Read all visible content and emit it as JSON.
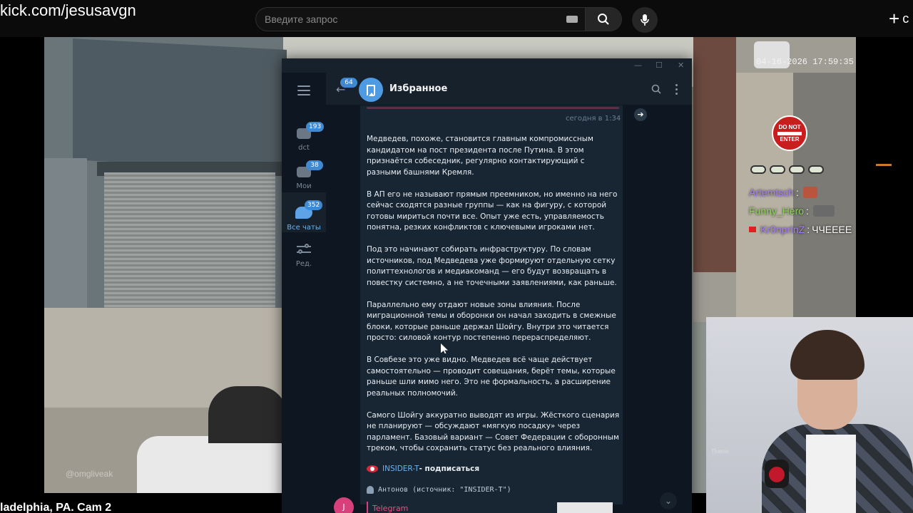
{
  "browser": {
    "url_text": "kick.com/jesusavgn",
    "search_placeholder": "Введите запрос",
    "icons": [
      "keyboard-icon",
      "search-icon",
      "mic-icon",
      "plus-icon"
    ],
    "create_label": "c"
  },
  "camera": {
    "timestamp": "04-16-2026 17:59:35",
    "caption": "ladelphia, PA. Cam 2",
    "watermark": "@omgliveak",
    "stop_sign": [
      "DO NOT",
      "ENTER"
    ]
  },
  "stream_chat": {
    "messages": [
      {
        "user": "Artemtsch",
        "color": "#a97bff",
        "text": ""
      },
      {
        "user": "Funny_Hero",
        "color": "#8bd35a",
        "text": ""
      },
      {
        "user": "Kr0nprInZ",
        "color": "#a97bff",
        "text": "ЧЧЕЕЕЕ"
      }
    ]
  },
  "webcam": {
    "label": "Пчела"
  },
  "telegram": {
    "window_controls": [
      "—",
      "☐",
      "✕"
    ],
    "folders": [
      {
        "label": "dct",
        "badge": "193",
        "icon": "chat-folder-icon"
      },
      {
        "label": "Мои друзья",
        "badge": "38",
        "icon": "chat-folder-icon"
      },
      {
        "label": "Все чаты",
        "badge": "352",
        "icon": "chats-icon",
        "active": true
      },
      {
        "label": "Ред.",
        "badge": "",
        "icon": "edit-folders-icon"
      }
    ],
    "back_badge": "64",
    "chat_title": "Избранное",
    "message": {
      "time": "сегодня в 1:34",
      "paragraphs": [
        "Медведев, похоже, становится главным компромиссным кандидатом на пост президента после Путина. В этом признаётся собеседник, регулярно контактирующий с разными башнями Кремля.",
        "В АП его не называют прямым преемником, но именно на него сейчас сходятся разные группы — как на фигуру, с которой готовы мириться почти все. Опыт уже есть, управляемость понятна, резких конфликтов с ключевыми игроками нет.",
        "Под это начинают собирать инфраструктуру. По словам источников, под Медведева уже формируют отдельную сетку политтехнологов и медиакоманд — его будут возвращать в повестку системно, а не точечными заявлениями, как раньше.",
        "Параллельно ему отдают новые зоны влияния. После миграционной темы и оборонки он начал заходить в смежные блоки, которые раньше держал Шойгу. Внутри это читается просто: силовой контур постепенно перераспределяют.",
        "В Совбезе это уже видно. Медведев всё чаще действует самостоятельно — проводит совещания, берёт темы, которые раньше шли мимо него. Это не формальность, а расширение реальных полномочий.",
        "Самого Шойгу аккуратно выводят из игры. Жёсткого сценария не планируют — обсуждают «мягкую посадку» через парламент. Базовый вариант — Совет Федерации с оборонным треком, чтобы сохранить статус без реального влияния."
      ],
      "insider_link": "INSIDER-T",
      "insider_sub": " - подписаться",
      "source": "Антонов (источник: \"INSIDER-T\")"
    },
    "next_message": {
      "avatar_letter": "J",
      "sender": "Telegram"
    }
  }
}
